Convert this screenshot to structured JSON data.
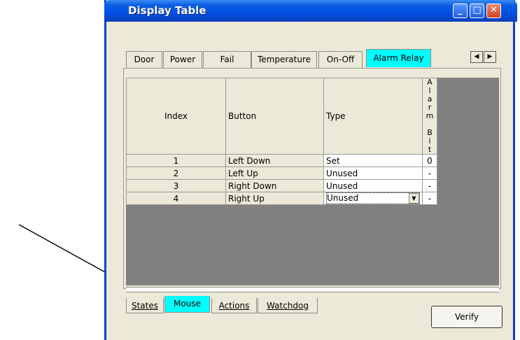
{
  "window": {
    "title": "Display Table"
  },
  "title_buttons": {
    "minimize": "_",
    "maximize": "□",
    "close": "✕"
  },
  "tabs": [
    "Door",
    "Power",
    "Fail",
    "Temperature",
    "On-Off",
    "Alarm Relay"
  ],
  "scroll_arrows": {
    "left": "◀",
    "right": "▶"
  },
  "table": {
    "headers": {
      "index": "Index",
      "button": "Button",
      "type": "Type",
      "alarm_bit": "Alarm Bit"
    },
    "rows": [
      {
        "index": "1",
        "button": "Left Down",
        "type": "Set",
        "bit": "0"
      },
      {
        "index": "2",
        "button": "Left Up",
        "type": "Unused",
        "bit": "-"
      },
      {
        "index": "3",
        "button": "Right Down",
        "type": "Unused",
        "bit": "-"
      },
      {
        "index": "4",
        "button": "Right Up",
        "type": "Unused",
        "bit": "-"
      }
    ],
    "dropdown_icon": "▼"
  },
  "bottom_tabs": [
    "States",
    "Mouse",
    "Actions",
    "Watchdog"
  ],
  "verify_label": "Verify",
  "colors": {
    "active_tab": "#00ffff",
    "title_bar": "#0050e6"
  }
}
